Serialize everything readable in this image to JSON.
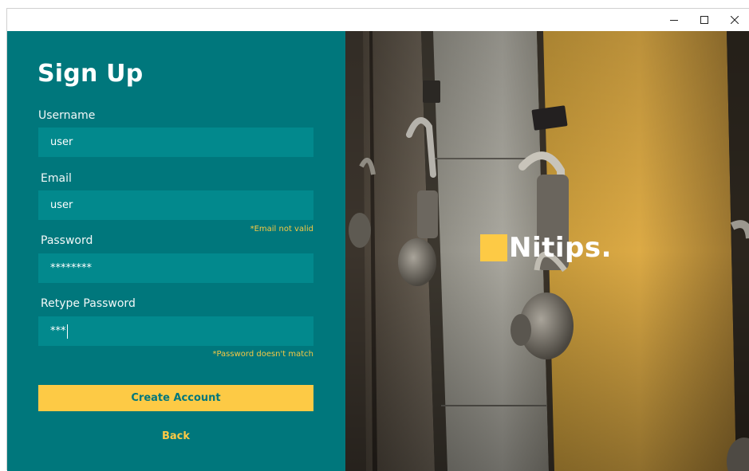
{
  "window": {
    "minimize_glyph": "—",
    "maximize_glyph": "□",
    "close_glyph": "✕"
  },
  "form": {
    "title": "Sign Up",
    "username": {
      "label": "Username",
      "value": "user"
    },
    "email": {
      "label": "Email",
      "value": "user",
      "error": "*Email not valid"
    },
    "password": {
      "label": "Password",
      "value": "********"
    },
    "retype_password": {
      "label": "Retype Password",
      "value": "***",
      "error": "*Password doesn't match"
    },
    "create_account_label": "Create Account",
    "back_label": "Back"
  },
  "brand": {
    "name": "Nitips."
  },
  "colors": {
    "panel_teal": "#00777c",
    "input_teal": "#02898d",
    "accent_yellow": "#fdca45"
  }
}
